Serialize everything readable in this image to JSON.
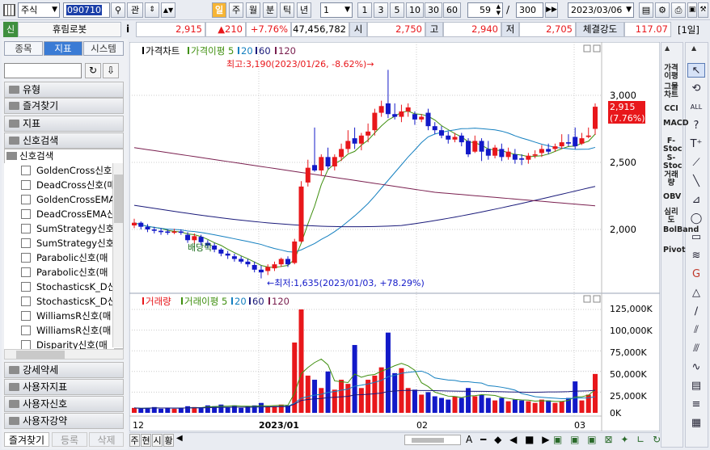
{
  "toolbar": {
    "market": "주식",
    "code": "090710",
    "btn_gwan": "관",
    "period_active": "일",
    "periods": [
      "주",
      "월",
      "분",
      "틱",
      "년"
    ],
    "interval_value": "1",
    "quick_counts": [
      "1",
      "3",
      "5",
      "10",
      "30",
      "60"
    ],
    "display_count": "59",
    "slash": "/",
    "total": "300",
    "date": "2023/03/06"
  },
  "quote": {
    "badge": "신",
    "name": "휴림로봇",
    "info_icon": "i",
    "price": "2,915",
    "change": "▲210",
    "pct": "+7.76%",
    "volume": "47,456,782",
    "open_label": "시",
    "open": "2,750",
    "high_label": "고",
    "high": "2,940",
    "low_label": "저",
    "low": "2,705",
    "strength_label": "체결강도",
    "strength": "117.07",
    "period_tag": "[1일]"
  },
  "left": {
    "tabs": [
      "종목",
      "지표",
      "시스템"
    ],
    "folders_top": [
      "유형",
      "즐겨찾기",
      "지표",
      "신호검색"
    ],
    "tree_root": "신호검색",
    "tree_items": [
      "GoldenCross신호",
      "DeadCross신호(매",
      "GoldenCrossEMA",
      "DeadCrossEMA신",
      "SumStrategy신호",
      "SumStrategy신호",
      "Parabolic신호(매",
      "Parabolic신호(매",
      "StochasticsK_D신",
      "StochasticsK_D신",
      "WilliamsR신호(매",
      "WilliamsR신호(매",
      "Disparity신호(매"
    ],
    "folders_bottom": [
      "강세약세",
      "사용자지표",
      "사용자신호",
      "사용자강약"
    ],
    "bottom_tabs": [
      "즐겨찾기",
      "등록",
      "삭제"
    ]
  },
  "price_chart": {
    "legend": [
      "가격차트",
      "가격이평 5",
      "20",
      "60",
      "120"
    ],
    "hi_note": "최고:3,190(2023/01/26, -8.62%)→",
    "lo_note": "←최저:1,635(2023/01/03, +78.29%)",
    "event_note": "배당락",
    "y_ticks": [
      "3,000",
      "2,500",
      "2,000"
    ],
    "last_price": "2,915",
    "last_pct": "(7.76%)"
  },
  "volume_chart": {
    "legend": [
      "거래량",
      "거래이평 5",
      "20",
      "60",
      "120"
    ],
    "y_ticks": [
      "125,000K",
      "100,000K",
      "75,000K",
      "50,000K",
      "25,000K",
      "0K"
    ]
  },
  "x_axis": [
    "12",
    "2023/01",
    "02",
    "03"
  ],
  "right_indicators": [
    "가격이평",
    "그물차트",
    "CCI",
    "MACD",
    "F-Stoc",
    "S-Stoc",
    "거래량",
    "OBV",
    "심리도",
    "BolBand",
    "Pivot"
  ],
  "bottom_bar": {
    "tabs": [
      "주",
      "현",
      "시",
      "황"
    ]
  },
  "colors": {
    "up": "#e8171b",
    "down": "#1219c8",
    "ma5": "#3f8f0f",
    "ma20": "#1580c0",
    "ma60": "#1a1a7a",
    "ma120": "#7a1f4f",
    "last_bg": "#e8171b"
  },
  "chart_data": {
    "type": "candlestick",
    "x_labels": [
      "12",
      "2023/01",
      "02",
      "03"
    ],
    "y_range": [
      1600,
      3250
    ],
    "high": {
      "value": 3190,
      "date": "2023/01/26"
    },
    "low": {
      "value": 1635,
      "date": "2023/01/03"
    },
    "last": 2915
  }
}
